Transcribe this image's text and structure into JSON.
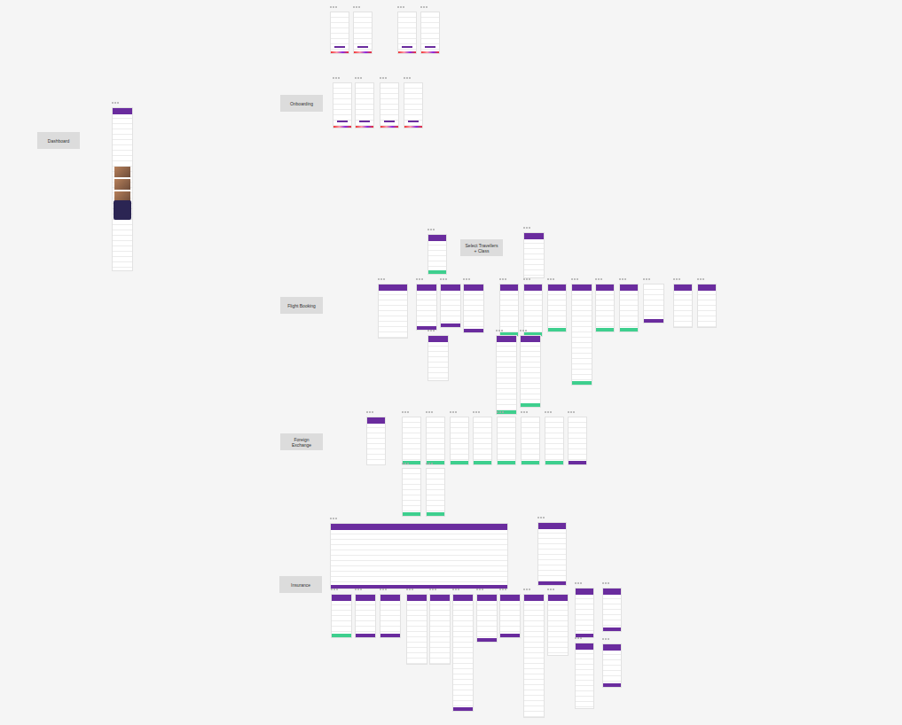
{
  "sections": [
    {
      "label": "Dashboard"
    },
    {
      "label": "Onboarding"
    },
    {
      "label": "Flight Booking"
    },
    {
      "label": "Select Travellers + Class"
    },
    {
      "label": "Foreign Exchange"
    },
    {
      "label": "Insurance"
    }
  ]
}
